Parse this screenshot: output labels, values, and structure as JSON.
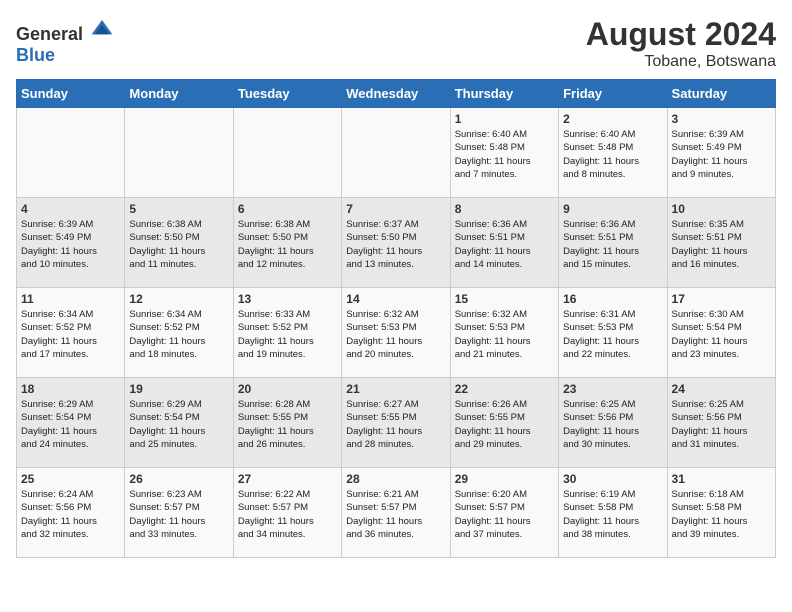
{
  "logo": {
    "general": "General",
    "blue": "Blue"
  },
  "title": "August 2024",
  "subtitle": "Tobane, Botswana",
  "weekdays": [
    "Sunday",
    "Monday",
    "Tuesday",
    "Wednesday",
    "Thursday",
    "Friday",
    "Saturday"
  ],
  "weeks": [
    [
      {
        "day": "",
        "info": ""
      },
      {
        "day": "",
        "info": ""
      },
      {
        "day": "",
        "info": ""
      },
      {
        "day": "",
        "info": ""
      },
      {
        "day": "1",
        "info": "Sunrise: 6:40 AM\nSunset: 5:48 PM\nDaylight: 11 hours\nand 7 minutes."
      },
      {
        "day": "2",
        "info": "Sunrise: 6:40 AM\nSunset: 5:48 PM\nDaylight: 11 hours\nand 8 minutes."
      },
      {
        "day": "3",
        "info": "Sunrise: 6:39 AM\nSunset: 5:49 PM\nDaylight: 11 hours\nand 9 minutes."
      }
    ],
    [
      {
        "day": "4",
        "info": "Sunrise: 6:39 AM\nSunset: 5:49 PM\nDaylight: 11 hours\nand 10 minutes."
      },
      {
        "day": "5",
        "info": "Sunrise: 6:38 AM\nSunset: 5:50 PM\nDaylight: 11 hours\nand 11 minutes."
      },
      {
        "day": "6",
        "info": "Sunrise: 6:38 AM\nSunset: 5:50 PM\nDaylight: 11 hours\nand 12 minutes."
      },
      {
        "day": "7",
        "info": "Sunrise: 6:37 AM\nSunset: 5:50 PM\nDaylight: 11 hours\nand 13 minutes."
      },
      {
        "day": "8",
        "info": "Sunrise: 6:36 AM\nSunset: 5:51 PM\nDaylight: 11 hours\nand 14 minutes."
      },
      {
        "day": "9",
        "info": "Sunrise: 6:36 AM\nSunset: 5:51 PM\nDaylight: 11 hours\nand 15 minutes."
      },
      {
        "day": "10",
        "info": "Sunrise: 6:35 AM\nSunset: 5:51 PM\nDaylight: 11 hours\nand 16 minutes."
      }
    ],
    [
      {
        "day": "11",
        "info": "Sunrise: 6:34 AM\nSunset: 5:52 PM\nDaylight: 11 hours\nand 17 minutes."
      },
      {
        "day": "12",
        "info": "Sunrise: 6:34 AM\nSunset: 5:52 PM\nDaylight: 11 hours\nand 18 minutes."
      },
      {
        "day": "13",
        "info": "Sunrise: 6:33 AM\nSunset: 5:52 PM\nDaylight: 11 hours\nand 19 minutes."
      },
      {
        "day": "14",
        "info": "Sunrise: 6:32 AM\nSunset: 5:53 PM\nDaylight: 11 hours\nand 20 minutes."
      },
      {
        "day": "15",
        "info": "Sunrise: 6:32 AM\nSunset: 5:53 PM\nDaylight: 11 hours\nand 21 minutes."
      },
      {
        "day": "16",
        "info": "Sunrise: 6:31 AM\nSunset: 5:53 PM\nDaylight: 11 hours\nand 22 minutes."
      },
      {
        "day": "17",
        "info": "Sunrise: 6:30 AM\nSunset: 5:54 PM\nDaylight: 11 hours\nand 23 minutes."
      }
    ],
    [
      {
        "day": "18",
        "info": "Sunrise: 6:29 AM\nSunset: 5:54 PM\nDaylight: 11 hours\nand 24 minutes."
      },
      {
        "day": "19",
        "info": "Sunrise: 6:29 AM\nSunset: 5:54 PM\nDaylight: 11 hours\nand 25 minutes."
      },
      {
        "day": "20",
        "info": "Sunrise: 6:28 AM\nSunset: 5:55 PM\nDaylight: 11 hours\nand 26 minutes."
      },
      {
        "day": "21",
        "info": "Sunrise: 6:27 AM\nSunset: 5:55 PM\nDaylight: 11 hours\nand 28 minutes."
      },
      {
        "day": "22",
        "info": "Sunrise: 6:26 AM\nSunset: 5:55 PM\nDaylight: 11 hours\nand 29 minutes."
      },
      {
        "day": "23",
        "info": "Sunrise: 6:25 AM\nSunset: 5:56 PM\nDaylight: 11 hours\nand 30 minutes."
      },
      {
        "day": "24",
        "info": "Sunrise: 6:25 AM\nSunset: 5:56 PM\nDaylight: 11 hours\nand 31 minutes."
      }
    ],
    [
      {
        "day": "25",
        "info": "Sunrise: 6:24 AM\nSunset: 5:56 PM\nDaylight: 11 hours\nand 32 minutes."
      },
      {
        "day": "26",
        "info": "Sunrise: 6:23 AM\nSunset: 5:57 PM\nDaylight: 11 hours\nand 33 minutes."
      },
      {
        "day": "27",
        "info": "Sunrise: 6:22 AM\nSunset: 5:57 PM\nDaylight: 11 hours\nand 34 minutes."
      },
      {
        "day": "28",
        "info": "Sunrise: 6:21 AM\nSunset: 5:57 PM\nDaylight: 11 hours\nand 36 minutes."
      },
      {
        "day": "29",
        "info": "Sunrise: 6:20 AM\nSunset: 5:57 PM\nDaylight: 11 hours\nand 37 minutes."
      },
      {
        "day": "30",
        "info": "Sunrise: 6:19 AM\nSunset: 5:58 PM\nDaylight: 11 hours\nand 38 minutes."
      },
      {
        "day": "31",
        "info": "Sunrise: 6:18 AM\nSunset: 5:58 PM\nDaylight: 11 hours\nand 39 minutes."
      }
    ]
  ]
}
